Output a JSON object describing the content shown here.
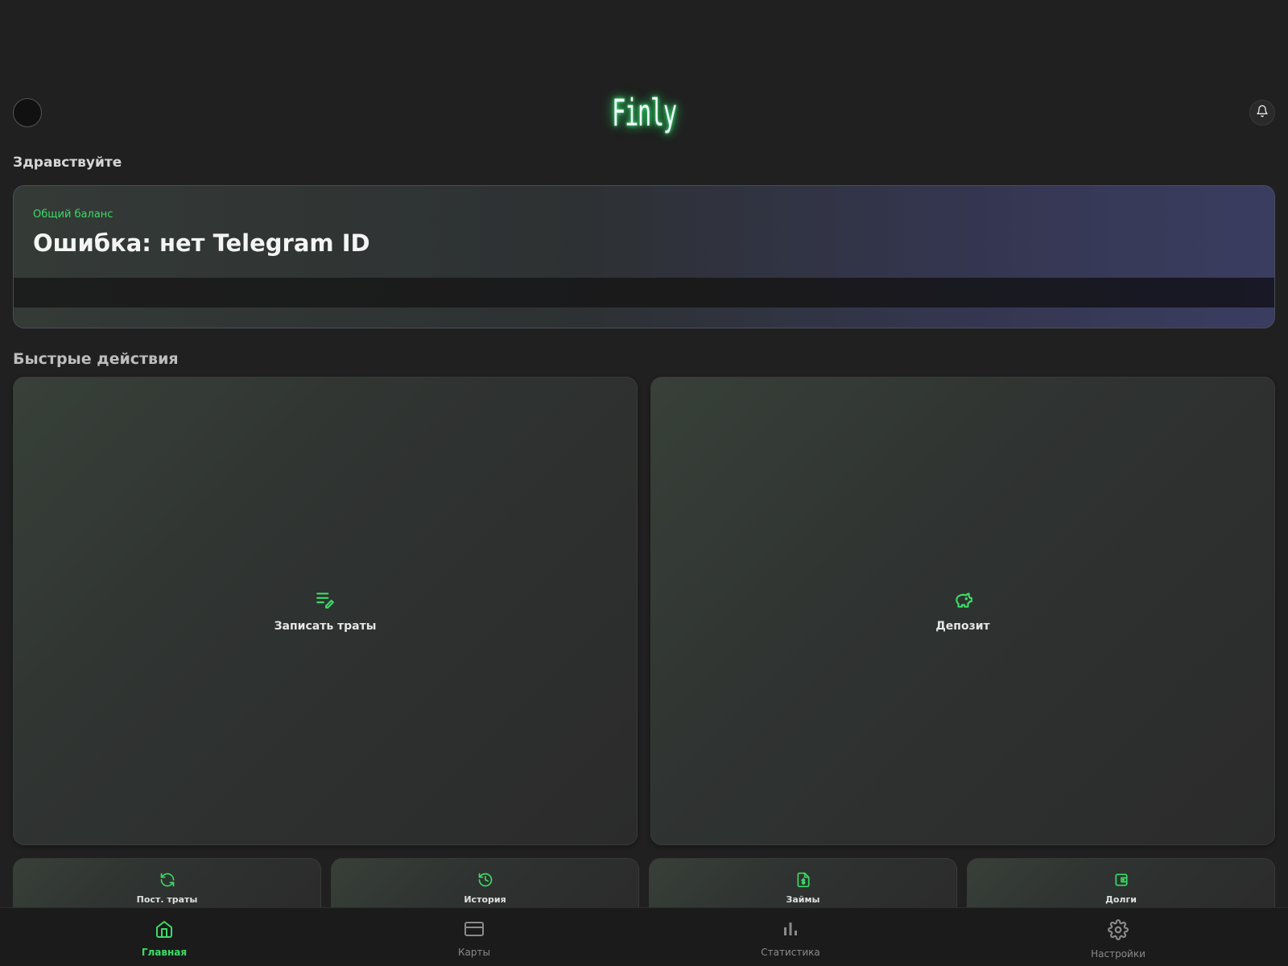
{
  "header": {
    "logo": "Finly"
  },
  "greeting": "Здравствуйте",
  "balance": {
    "label": "Общий баланс",
    "value": "Ошибка: нет Telegram ID"
  },
  "quick_actions": {
    "title": "Быстрые действия",
    "primary": [
      {
        "label": "Записать траты",
        "icon": "list-edit-icon"
      },
      {
        "label": "Депозит",
        "icon": "piggy-bank-icon"
      }
    ],
    "secondary": [
      {
        "label": "Пост. траты",
        "icon": "refresh-icon"
      },
      {
        "label": "История",
        "icon": "history-icon"
      },
      {
        "label": "Займы",
        "icon": "dollar-document-icon"
      },
      {
        "label": "Долги",
        "icon": "wallet-icon"
      }
    ]
  },
  "nav": {
    "items": [
      {
        "label": "Главная",
        "icon": "home-icon",
        "active": true
      },
      {
        "label": "Карты",
        "icon": "card-icon",
        "active": false
      },
      {
        "label": "Статистика",
        "icon": "bar-chart-icon",
        "active": false
      },
      {
        "label": "Настройки",
        "icon": "gear-icon",
        "active": false
      }
    ]
  },
  "colors": {
    "accent": "#3ddb67",
    "background": "#202020"
  }
}
